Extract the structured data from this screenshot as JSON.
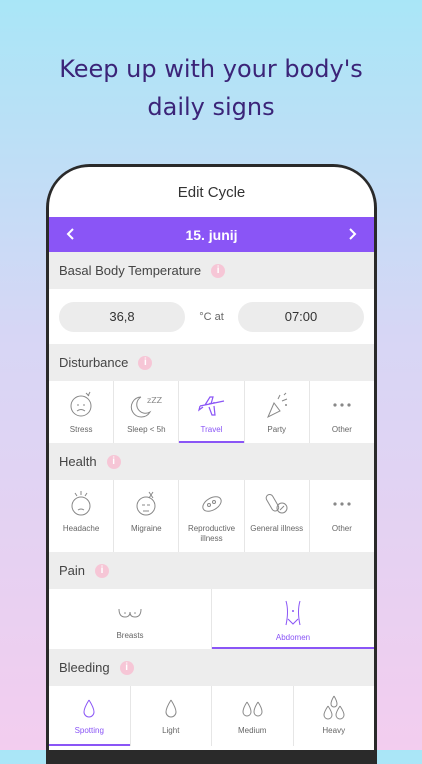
{
  "promo": {
    "line1": "Keep up with your body's",
    "line2": "daily signs"
  },
  "screen_title": "Edit Cycle",
  "date": {
    "label": "15. junij",
    "prev_icon": "chevron-left-icon",
    "next_icon": "chevron-right-icon"
  },
  "colors": {
    "accent": "#8a55f6",
    "info": "#f6c6d6"
  },
  "temperature": {
    "title": "Basal Body Temperature",
    "value": "36,8",
    "unit": "°C at",
    "time": "07:00"
  },
  "disturbance": {
    "title": "Disturbance",
    "items": [
      {
        "label": "Stress",
        "icon": "stress-face-icon"
      },
      {
        "label": "Sleep < 5h",
        "icon": "sleep-icon"
      },
      {
        "label": "Travel",
        "icon": "airplane-icon",
        "selected": true
      },
      {
        "label": "Party",
        "icon": "party-popper-icon"
      },
      {
        "label": "Other",
        "icon": "more-icon"
      }
    ]
  },
  "health": {
    "title": "Health",
    "items": [
      {
        "label": "Headache",
        "icon": "headache-icon"
      },
      {
        "label": "Migraine",
        "icon": "migraine-icon"
      },
      {
        "label": "Reproductive illness",
        "icon": "bacteria-icon"
      },
      {
        "label": "General illness",
        "icon": "pills-icon"
      },
      {
        "label": "Other",
        "icon": "more-icon"
      }
    ]
  },
  "pain": {
    "title": "Pain",
    "items": [
      {
        "label": "Breasts",
        "icon": "breasts-icon"
      },
      {
        "label": "Abdomen",
        "icon": "abdomen-icon",
        "selected": true
      }
    ]
  },
  "bleeding": {
    "title": "Bleeding",
    "items": [
      {
        "label": "Spotting",
        "icon": "drop-icon",
        "selected": true
      },
      {
        "label": "Light",
        "icon": "drop-icon"
      },
      {
        "label": "Medium",
        "icon": "drops-icon"
      },
      {
        "label": "Heavy",
        "icon": "drops-heavy-icon"
      }
    ]
  }
}
